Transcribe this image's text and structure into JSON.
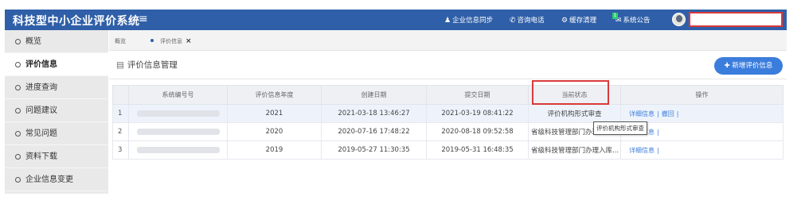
{
  "header": {
    "title": "科技型中小企业评价系统",
    "menu_icon": "hamburger-icon",
    "links": [
      {
        "label": "企业信息同步",
        "icon": "user-icon"
      },
      {
        "label": "咨询电话",
        "icon": "phone-icon"
      },
      {
        "label": "缓存清理",
        "icon": "gear-icon"
      },
      {
        "label": "系统公告",
        "icon": "mail-icon",
        "badge": "1"
      }
    ],
    "avatar": "user-avatar",
    "username": ""
  },
  "sidebar": {
    "items": [
      {
        "label": "概览"
      },
      {
        "label": "评价信息",
        "active": true
      },
      {
        "label": "进度查询"
      },
      {
        "label": "问题建议"
      },
      {
        "label": "常见问题"
      },
      {
        "label": "资料下载"
      },
      {
        "label": "企业信息变更"
      }
    ]
  },
  "tabs": [
    {
      "label": "概览"
    },
    {
      "label": "评价信息",
      "close": "×"
    }
  ],
  "page": {
    "title": "评价信息管理",
    "add_button": "新增评价信息"
  },
  "table": {
    "columns": [
      "系统编号号",
      "评价信息年度",
      "创建日期",
      "提交日期",
      "当前状态",
      "操作"
    ],
    "rows": [
      {
        "index": "1",
        "year": "2021",
        "created": "2021-03-18 13:46:27",
        "submitted": "2021-03-19 08:41:22",
        "status": "评价机构形式审查",
        "actions": [
          "详细信息",
          "撤回"
        ]
      },
      {
        "index": "2",
        "year": "2020",
        "created": "2020-07-16 17:48:22",
        "submitted": "2020-08-18 09:52:58",
        "status": "省级科技管理部门办理入库",
        "actions": [
          "详细信息"
        ]
      },
      {
        "index": "3",
        "year": "2019",
        "created": "2019-05-27 11:30:35",
        "submitted": "2019-05-31 16:48:35",
        "status": "省级科技管理部门办理入库...",
        "actions": [
          "详细信息"
        ]
      }
    ]
  },
  "tooltip": "评价机构形式审查",
  "colors": {
    "header": "#2f5fa8",
    "accent": "#3b7ddd",
    "highlight": "#d93a3a"
  }
}
